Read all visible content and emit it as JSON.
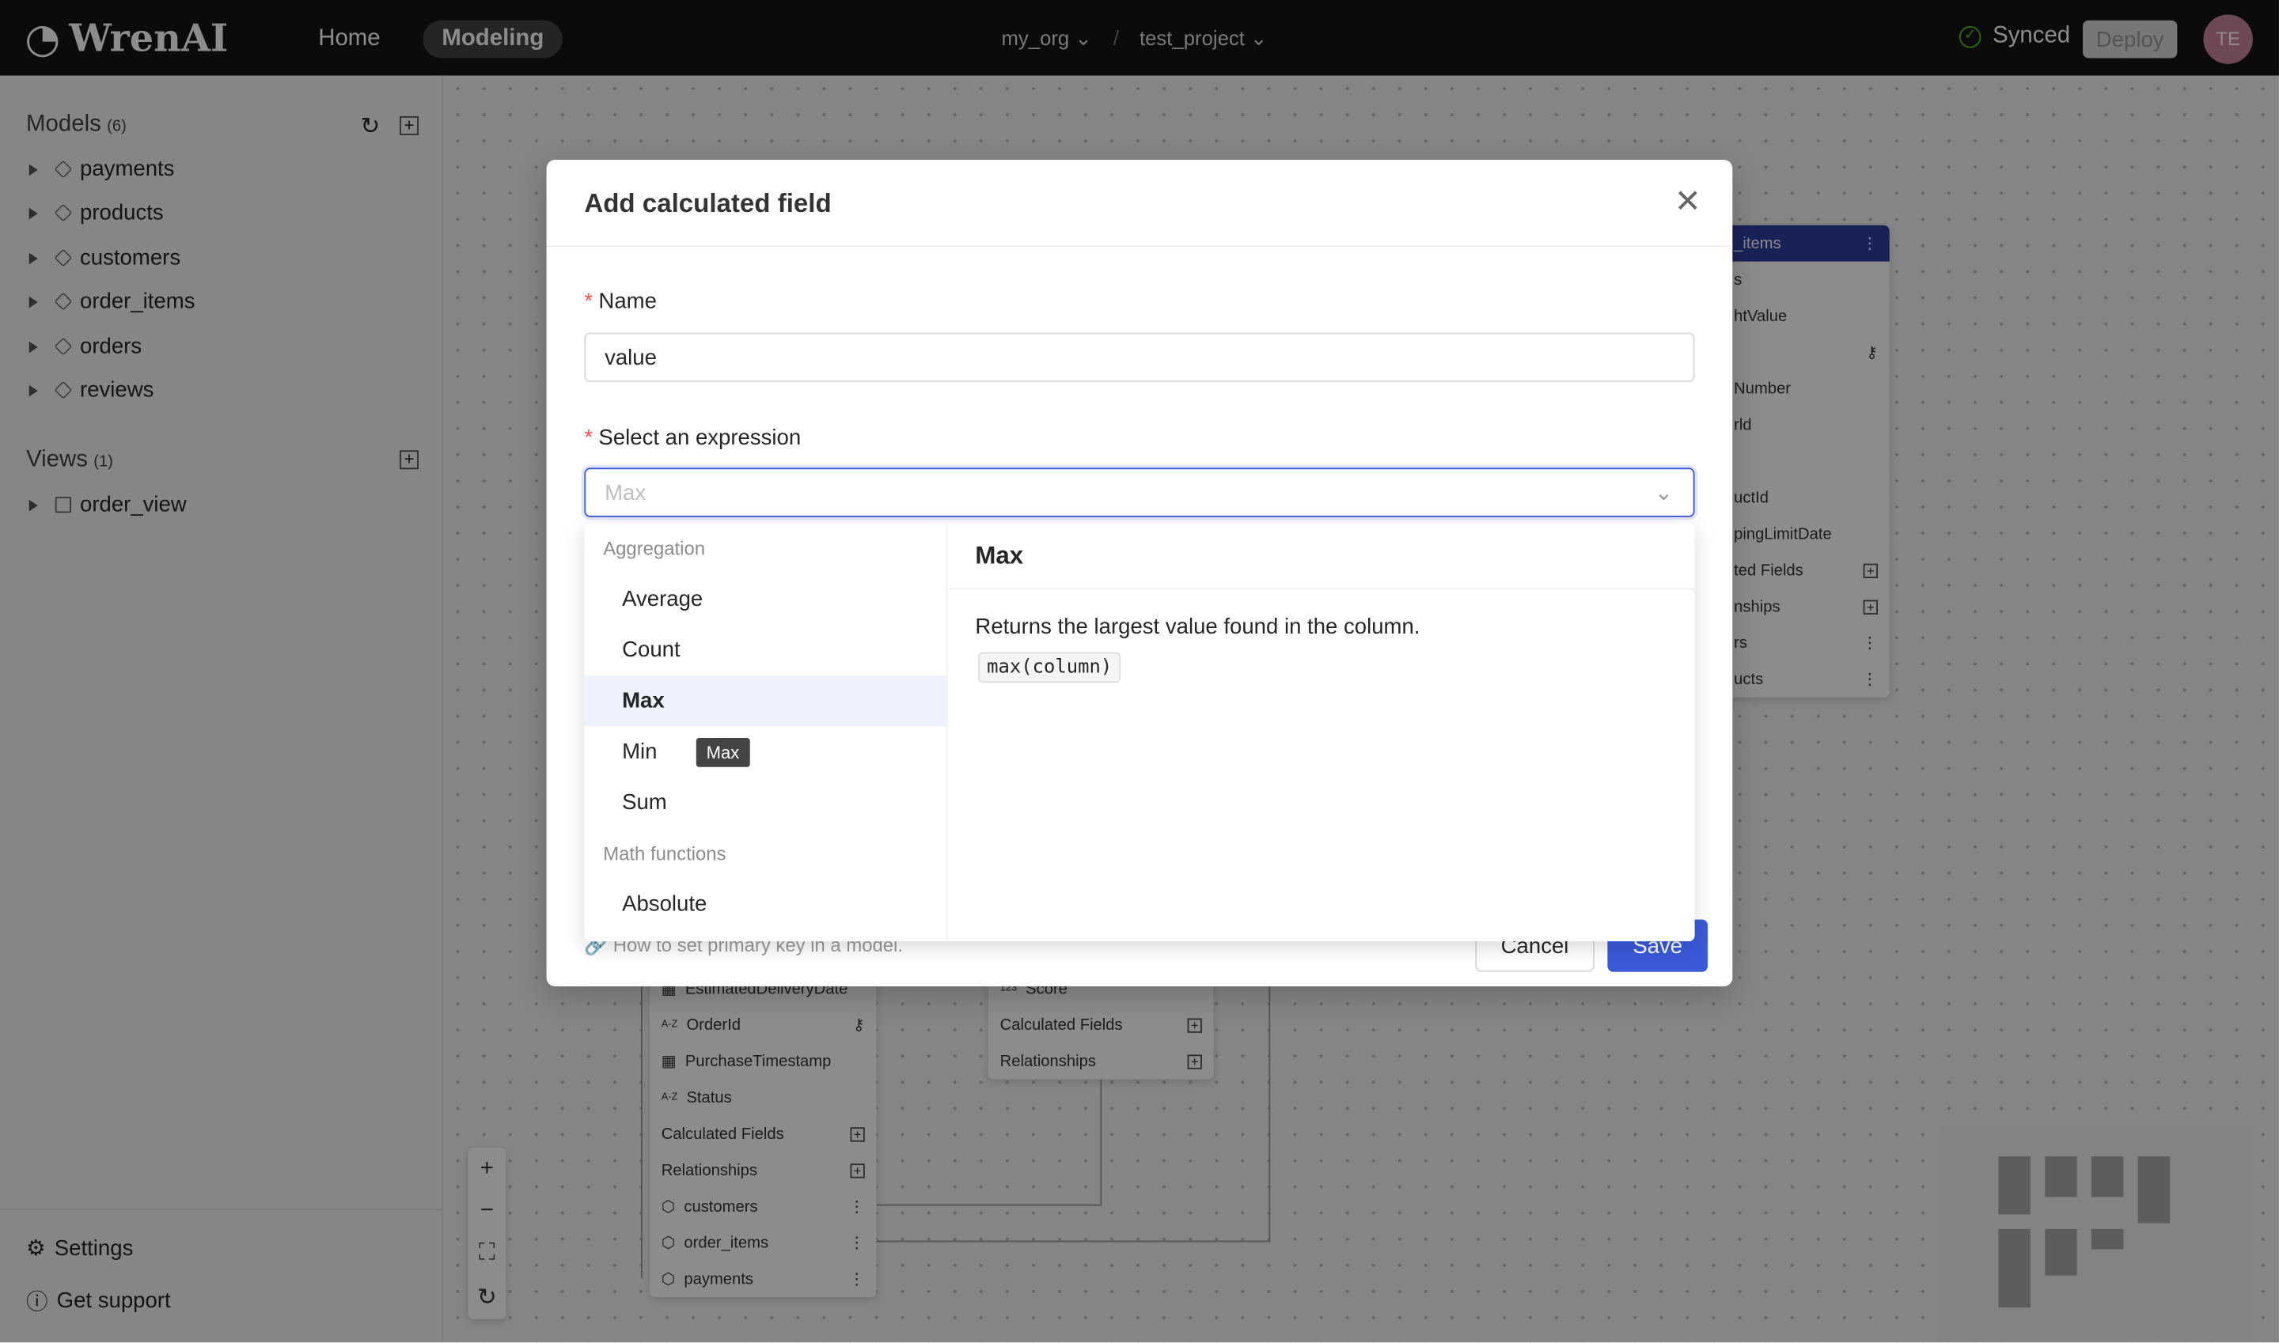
{
  "topbar": {
    "logo": "WrenAI",
    "nav": [
      "Home",
      "Modeling"
    ],
    "active_nav": "Modeling",
    "org": "my_org",
    "separator": "/",
    "project": "test_project",
    "status": "Synced",
    "deploy": "Deploy",
    "avatar": "TE",
    "avatar_color": "#c8839c"
  },
  "sidebar": {
    "models_title": "Models",
    "models_count": "(6)",
    "models": [
      "payments",
      "products",
      "customers",
      "order_items",
      "orders",
      "reviews"
    ],
    "views_title": "Views",
    "views_count": "(1)",
    "views": [
      "order_view"
    ],
    "settings": "Settings",
    "support": "Get support"
  },
  "canvas": {
    "node_right": {
      "header": "_items",
      "rows": [
        "s",
        "htValue",
        "",
        "Number",
        "rld",
        "",
        "uctId",
        "pingLimitDate",
        "ted Fields",
        "nships",
        "rs",
        "ucts"
      ]
    },
    "node_left": {
      "rows": [
        "EstimatedDeliveryDate",
        "OrderId",
        "PurchaseTimestamp",
        "Status",
        "Calculated Fields",
        "Relationships",
        "customers",
        "order_items",
        "payments"
      ]
    },
    "node_mid": {
      "rows": [
        "Score",
        "Calculated Fields",
        "Relationships"
      ]
    },
    "header_color": "#2f3f9e"
  },
  "modal": {
    "title": "Add calculated field",
    "name_label": "Name",
    "name_value": "value",
    "expr_label": "Select an expression",
    "expr_placeholder": "Max",
    "groups": [
      {
        "label": "Aggregation",
        "options": [
          "Average",
          "Count",
          "Max",
          "Min",
          "Sum"
        ]
      },
      {
        "label": "Math functions",
        "options": [
          "Absolute"
        ]
      }
    ],
    "selected": "Max",
    "tooltip": "Max",
    "detail": {
      "title": "Max",
      "description": "Returns the largest value found in the column.",
      "syntax": "max(column)"
    },
    "hint": "How to set primary key in a model.",
    "cancel": "Cancel",
    "save": "Save",
    "accent": "#3a5ad9"
  }
}
